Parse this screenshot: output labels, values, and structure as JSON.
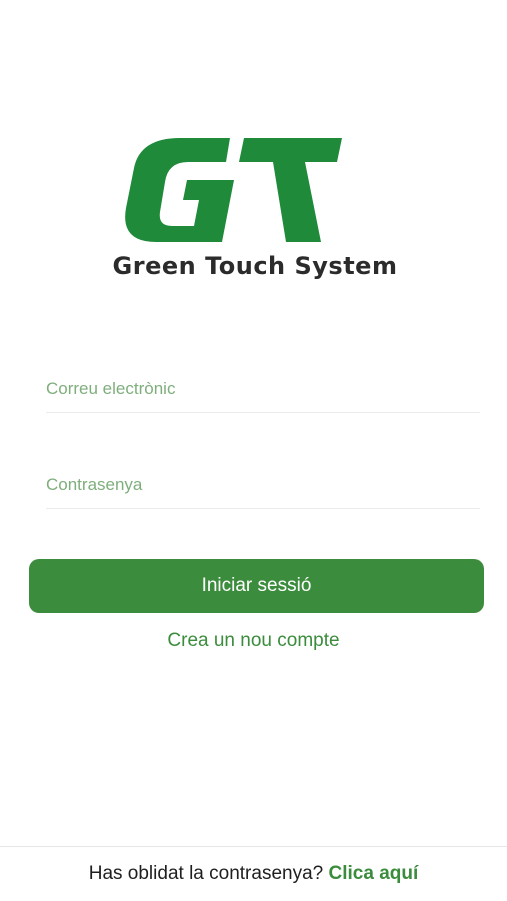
{
  "logo": {
    "wordmark": "Green Touch System",
    "brand_color": "#1f8b3a"
  },
  "form": {
    "email_placeholder": "Correu electrònic",
    "email_value": "",
    "password_placeholder": "Contrasenya",
    "password_value": "",
    "login_label": "Iniciar sessió",
    "signup_label": "Crea un nou compte"
  },
  "footer": {
    "question": "Has oblidat la contrasenya?",
    "link": "Clica aquí"
  },
  "colors": {
    "accent": "#3b8c3d",
    "placeholder": "#7fae7d"
  }
}
